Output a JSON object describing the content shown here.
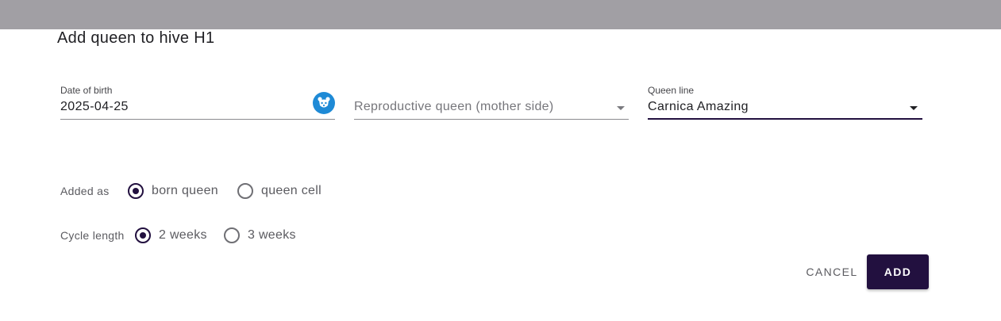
{
  "colors": {
    "primary": "#22103f",
    "backdrop": "#a19fa4",
    "date_icon_bg": "#1e8ad6"
  },
  "dialog": {
    "title": "Add queen to hive H1",
    "date_of_birth": {
      "label": "Date of birth",
      "value": "2025-04-25",
      "icon": "bee-face-icon"
    },
    "mother_queen": {
      "placeholder": "Reproductive queen (mother side)",
      "icon": "chevron-down-icon"
    },
    "queen_line": {
      "label": "Queen line",
      "value": "Carnica Amazing",
      "icon": "chevron-down-icon"
    },
    "added_as": {
      "label": "Added as",
      "options": [
        {
          "label": "born queen",
          "checked": true
        },
        {
          "label": "queen cell",
          "checked": false
        }
      ]
    },
    "cycle_length": {
      "label": "Cycle length",
      "options": [
        {
          "label": "2 weeks",
          "checked": true
        },
        {
          "label": "3 weeks",
          "checked": false
        }
      ]
    },
    "actions": {
      "cancel_label": "CANCEL",
      "add_label": "ADD"
    }
  }
}
